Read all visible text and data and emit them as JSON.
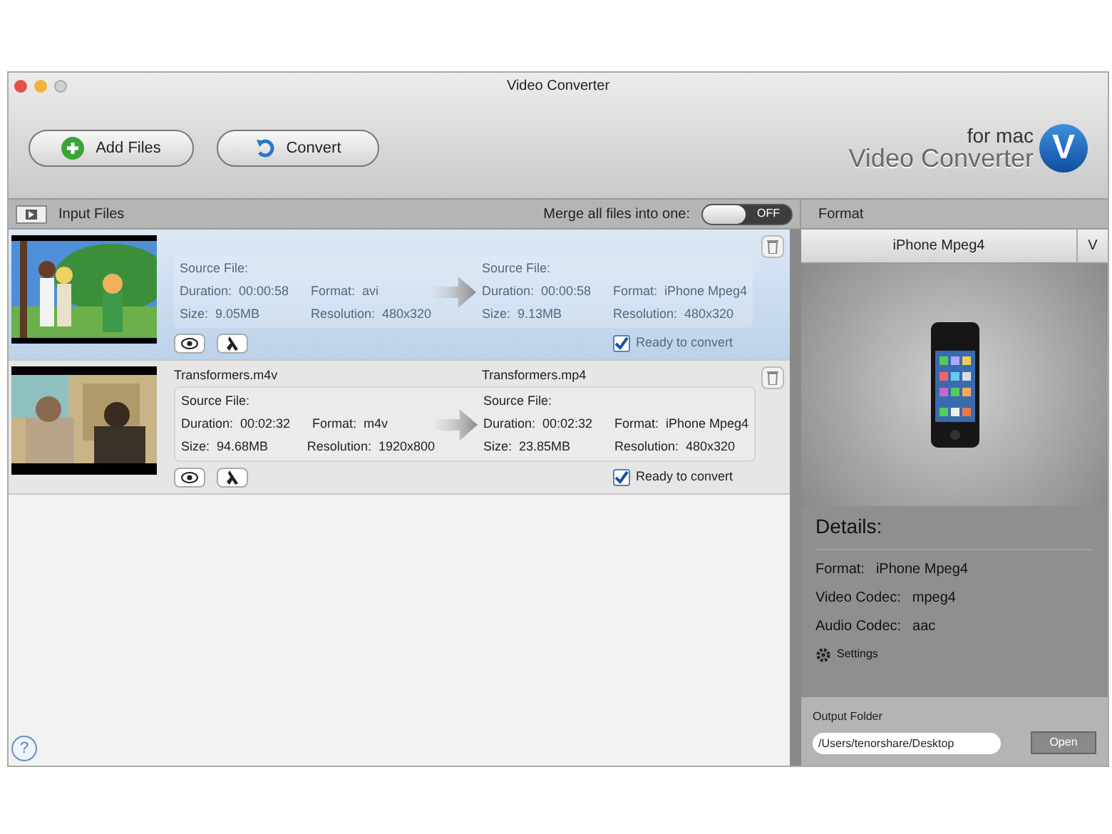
{
  "window": {
    "title": "Video Converter"
  },
  "toolbar": {
    "buttons": [
      {
        "kind": "add",
        "label": "Add Files"
      },
      {
        "kind": "convert",
        "label": "Convert"
      }
    ],
    "logo": {
      "small": "for mac",
      "big": "Video Converter",
      "mark": "V"
    }
  },
  "header": {
    "input_label": "Input Files",
    "merge_label": "Merge all files into one:",
    "merge_on": false,
    "merge_state": "OFF",
    "format_label": "Format"
  },
  "files": [
    {
      "selected": true,
      "source": {
        "heading": "Source File:",
        "duration": "Duration:  00:00:58",
        "format": "Format:  avi",
        "size": "Size:  9.05MB",
        "resolution": "Resolution:  480x320"
      },
      "target": {
        "heading": "Source File:",
        "duration": "Duration:  00:00:58",
        "format": "Format:  iPhone Mpeg4",
        "size": "Size:  9.13MB",
        "resolution": "Resolution:  480x320"
      },
      "ready_label": "Ready to convert",
      "ready": true
    },
    {
      "selected": false,
      "source": {
        "name": "Transformers.m4v",
        "heading": "Source File:",
        "duration": "Duration:  00:02:32",
        "format": "Format:  m4v",
        "size": "Size:  94.68MB",
        "resolution": "Resolution:  1920x800"
      },
      "target": {
        "name": "Transformers.mp4",
        "heading": "Source File:",
        "duration": "Duration:  00:02:32",
        "format": "Format:  iPhone Mpeg4",
        "size": "Size:  23.85MB",
        "resolution": "Resolution:  480x320"
      },
      "ready_label": "Ready to convert",
      "ready": true
    }
  ],
  "format_panel": {
    "selected": "iPhone Mpeg4",
    "toggle": "V",
    "details_title": "Details:",
    "details": [
      {
        "label": "Format:",
        "value": "iPhone Mpeg4"
      },
      {
        "label": "Video Codec:",
        "value": "mpeg4"
      },
      {
        "label": "Audio Codec:",
        "value": "aac"
      }
    ],
    "settings": "Settings",
    "output_label": "Output Folder",
    "output_path": "/Users/tenorshare/Desktop",
    "open": "Open"
  },
  "help": "?"
}
